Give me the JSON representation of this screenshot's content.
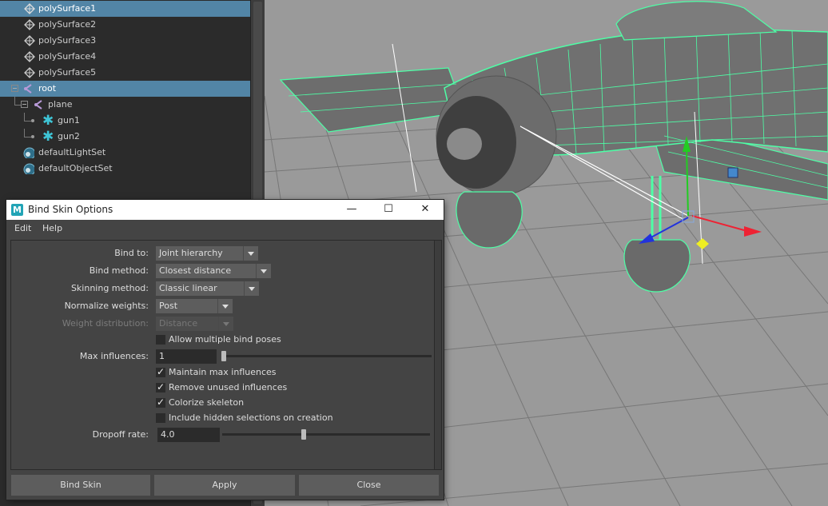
{
  "outliner": {
    "items": [
      {
        "label": "polySurface1",
        "icon": "mesh-icon",
        "selected": true
      },
      {
        "label": "polySurface2",
        "icon": "mesh-icon"
      },
      {
        "label": "polySurface3",
        "icon": "mesh-icon"
      },
      {
        "label": "polySurface4",
        "icon": "mesh-icon"
      },
      {
        "label": "polySurface5",
        "icon": "mesh-icon"
      },
      {
        "label": "root",
        "icon": "joint-icon",
        "selected": true
      },
      {
        "label": "plane",
        "icon": "joint-icon"
      },
      {
        "label": "gun1",
        "icon": "locator-icon"
      },
      {
        "label": "gun2",
        "icon": "locator-icon"
      },
      {
        "label": "defaultLightSet",
        "icon": "set-icon"
      },
      {
        "label": "defaultObjectSet",
        "icon": "set-icon"
      }
    ]
  },
  "dialog": {
    "logo": "M",
    "title": "Bind Skin Options",
    "window_controls": {
      "minimize": "—",
      "maximize": "☐",
      "close": "✕"
    },
    "menu": [
      "Edit",
      "Help"
    ],
    "fields": {
      "bind_to": {
        "label": "Bind to:",
        "value": "Joint hierarchy"
      },
      "bind_method": {
        "label": "Bind method:",
        "value": "Closest distance"
      },
      "skinning_method": {
        "label": "Skinning method:",
        "value": "Classic linear"
      },
      "normalize_weights": {
        "label": "Normalize weights:",
        "value": "Post"
      },
      "weight_distribution": {
        "label": "Weight distribution:",
        "value": "Distance",
        "enabled": false
      },
      "allow_multiple": {
        "label": "Allow multiple bind poses",
        "checked": false
      },
      "max_influences": {
        "label": "Max influences:",
        "value": "1",
        "slider_fraction": 0.0
      },
      "maintain_max": {
        "label": "Maintain max influences",
        "checked": true
      },
      "remove_unused": {
        "label": "Remove unused influences",
        "checked": true
      },
      "colorize": {
        "label": "Colorize skeleton",
        "checked": true
      },
      "include_hidden": {
        "label": "Include hidden selections on creation",
        "checked": false
      },
      "dropoff_rate": {
        "label": "Dropoff rate:",
        "value": "4.0",
        "slider_fraction": 0.39
      }
    },
    "buttons": {
      "bind": "Bind Skin",
      "apply": "Apply",
      "close": "Close"
    }
  },
  "colors": {
    "selection": "#5285a6",
    "wireframe": "#4dffa6",
    "viewport_bg": "#9a9a9a",
    "maya_accent": "#22a4b6"
  }
}
